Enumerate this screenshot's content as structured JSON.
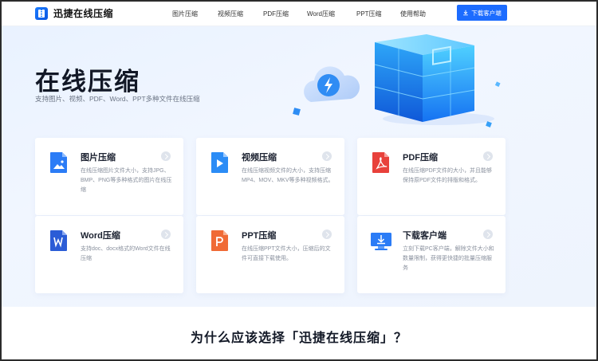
{
  "brand": {
    "name": "迅捷在线压缩"
  },
  "nav": {
    "items": [
      {
        "label": "图片压缩"
      },
      {
        "label": "视频压缩"
      },
      {
        "label": "PDF压缩"
      },
      {
        "label": "Word压缩"
      },
      {
        "label": "PPT压缩"
      },
      {
        "label": "使用帮助"
      }
    ],
    "download_label": "下载客户端"
  },
  "hero": {
    "title": "在线压缩",
    "subtitle": "支持图片、视频、PDF、Word、PPT多种文件在线压缩"
  },
  "cards": [
    {
      "title": "图片压缩",
      "desc": "在线压缩图片文件大小，支持JPG、BMP、PNG等多种格式的图片在线压缩",
      "icon": "image-file-icon",
      "color": "#2b7cf6"
    },
    {
      "title": "视频压缩",
      "desc": "在线压缩视频文件的大小，支持压缩MP4、MOV、MKV等多种视频格式。",
      "icon": "video-file-icon",
      "color": "#2b8cf6"
    },
    {
      "title": "PDF压缩",
      "desc": "在线压缩PDF文件的大小，并且能够保持原PDF文件的排版和格式。",
      "icon": "pdf-file-icon",
      "color": "#e8413b"
    },
    {
      "title": "Word压缩",
      "desc": "支持doc、docx格式的Word文件在线压缩",
      "icon": "word-file-icon",
      "color": "#2b5cd6"
    },
    {
      "title": "PPT压缩",
      "desc": "在线压缩PPT文件大小，压缩后的文件可直接下载使用。",
      "icon": "ppt-file-icon",
      "color": "#f06a35"
    },
    {
      "title": "下载客户端",
      "desc": "立刻下载PC客户端，解除文件大小和数量限制，获得更快捷的批量压缩服务",
      "icon": "monitor-download-icon",
      "color": "#2b7cf6"
    }
  ],
  "section": {
    "title": "为什么应该选择「迅捷在线压缩」？"
  }
}
